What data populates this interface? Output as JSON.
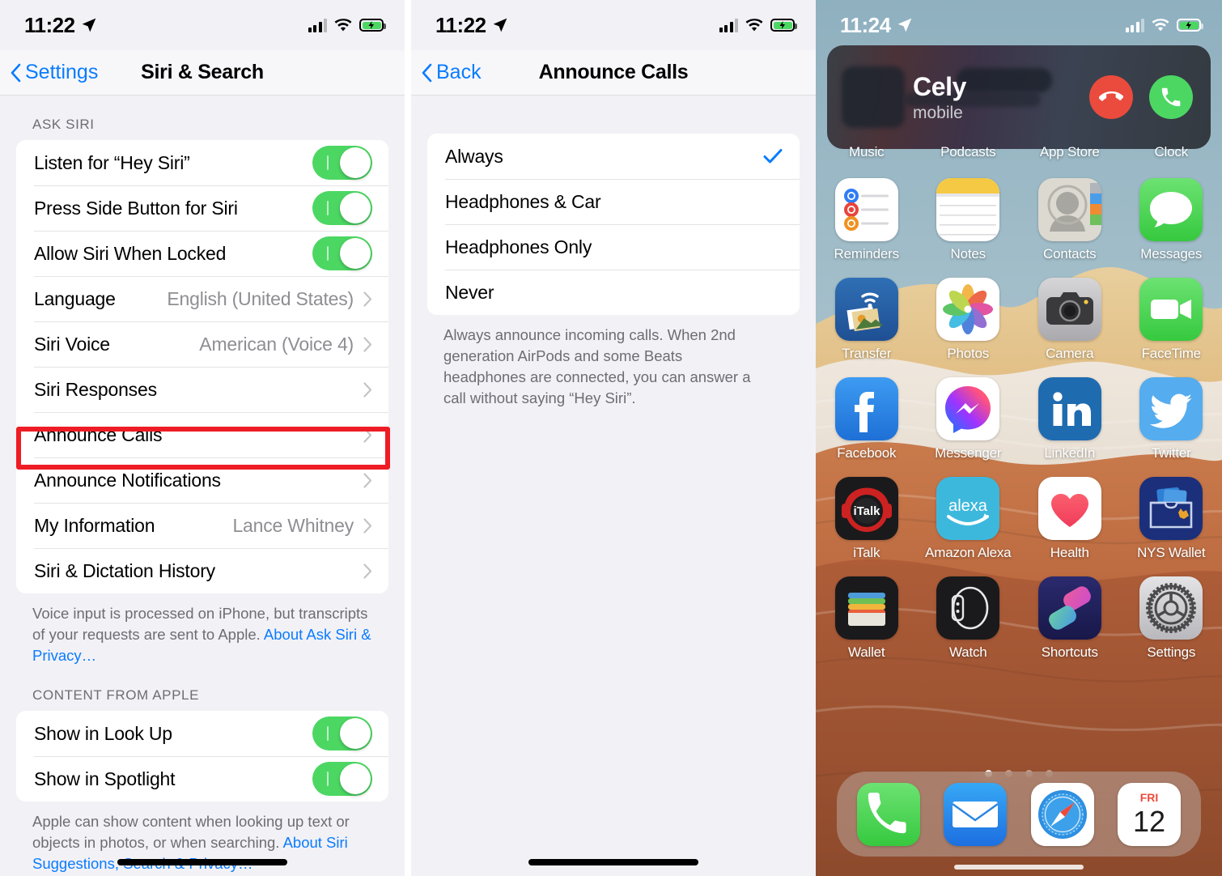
{
  "panel_settings": {
    "statusbar": {
      "time": "11:22",
      "location_icon": "location-arrow-icon",
      "signal_icon": "cellular-signal-icon",
      "wifi_icon": "wifi-icon",
      "battery_icon": "battery-charging-icon"
    },
    "nav": {
      "back_label": "Settings",
      "title": "Siri & Search"
    },
    "sections": [
      {
        "header": "ASK SIRI",
        "rows": [
          {
            "label": "Listen for “Hey Siri”",
            "type": "toggle",
            "on": true
          },
          {
            "label": "Press Side Button for Siri",
            "type": "toggle",
            "on": true
          },
          {
            "label": "Allow Siri When Locked",
            "type": "toggle",
            "on": true
          },
          {
            "label": "Language",
            "type": "disclosure",
            "value": "English (United States)"
          },
          {
            "label": "Siri Voice",
            "type": "disclosure",
            "value": "American (Voice 4)"
          },
          {
            "label": "Siri Responses",
            "type": "disclosure",
            "value": ""
          },
          {
            "label": "Announce Calls",
            "type": "disclosure",
            "value": "",
            "highlighted": true
          },
          {
            "label": "Announce Notifications",
            "type": "disclosure",
            "value": ""
          },
          {
            "label": "My Information",
            "type": "disclosure",
            "value": "Lance Whitney"
          },
          {
            "label": "Siri & Dictation History",
            "type": "disclosure",
            "value": ""
          }
        ],
        "footer_text": "Voice input is processed on iPhone, but transcripts of your requests are sent to Apple. ",
        "footer_link": "About Ask Siri & Privacy…"
      },
      {
        "header": "CONTENT FROM APPLE",
        "rows": [
          {
            "label": "Show in Look Up",
            "type": "toggle",
            "on": true
          },
          {
            "label": "Show in Spotlight",
            "type": "toggle",
            "on": true
          }
        ],
        "footer_text": "Apple can show content when looking up text or objects in photos, or when searching. ",
        "footer_link": "About Siri Suggestions, Search & Privacy…"
      }
    ],
    "highlight_color": "#ee1c25"
  },
  "panel_announce": {
    "statusbar": {
      "time": "11:22"
    },
    "nav": {
      "back_label": "Back",
      "title": "Announce Calls"
    },
    "options": [
      {
        "label": "Always",
        "selected": true
      },
      {
        "label": "Headphones & Car",
        "selected": false
      },
      {
        "label": "Headphones Only",
        "selected": false
      },
      {
        "label": "Never",
        "selected": false
      }
    ],
    "footer_text": "Always announce incoming calls. When 2nd generation AirPods and some Beats headphones are connected, you can answer a call without saying “Hey Siri”.",
    "accent_color": "#0a7cff"
  },
  "panel_home": {
    "statusbar": {
      "time": "11:24"
    },
    "call_banner": {
      "caller_name": "Cely",
      "caller_label": "mobile",
      "decline_label": "decline-call",
      "accept_label": "accept-call",
      "decline_color": "#eb4b3c",
      "accept_color": "#4cd763"
    },
    "app_rows": [
      {
        "labels_only": true,
        "labels": [
          "Music",
          "Podcasts",
          "App Store",
          "Clock"
        ]
      },
      {
        "labels_only": false,
        "apps": [
          {
            "label": "Reminders",
            "icon": "reminders-icon"
          },
          {
            "label": "Notes",
            "icon": "notes-icon"
          },
          {
            "label": "Contacts",
            "icon": "contacts-icon"
          },
          {
            "label": "Messages",
            "icon": "messages-icon"
          }
        ]
      },
      {
        "labels_only": false,
        "apps": [
          {
            "label": "Transfer",
            "icon": "transfer-icon"
          },
          {
            "label": "Photos",
            "icon": "photos-icon"
          },
          {
            "label": "Camera",
            "icon": "camera-icon"
          },
          {
            "label": "FaceTime",
            "icon": "facetime-icon"
          }
        ]
      },
      {
        "labels_only": false,
        "apps": [
          {
            "label": "Facebook",
            "icon": "facebook-icon"
          },
          {
            "label": "Messenger",
            "icon": "messenger-icon"
          },
          {
            "label": "LinkedIn",
            "icon": "linkedin-icon"
          },
          {
            "label": "Twitter",
            "icon": "twitter-icon"
          }
        ]
      },
      {
        "labels_only": false,
        "apps": [
          {
            "label": "iTalk",
            "icon": "italk-icon"
          },
          {
            "label": "Amazon Alexa",
            "icon": "alexa-icon"
          },
          {
            "label": "Health",
            "icon": "health-icon"
          },
          {
            "label": "NYS Wallet",
            "icon": "nys-wallet-icon"
          }
        ]
      },
      {
        "labels_only": false,
        "apps": [
          {
            "label": "Wallet",
            "icon": "wallet-icon"
          },
          {
            "label": "Watch",
            "icon": "watch-icon"
          },
          {
            "label": "Shortcuts",
            "icon": "shortcuts-icon"
          },
          {
            "label": "Settings",
            "icon": "settings-icon"
          }
        ]
      }
    ],
    "page_dots": {
      "count": 4,
      "active_index": 0
    },
    "dock": [
      {
        "label": "phone-icon"
      },
      {
        "label": "mail-icon"
      },
      {
        "label": "safari-icon"
      },
      {
        "label": "calendar-icon",
        "weekday": "FRI",
        "day": "12"
      }
    ]
  }
}
